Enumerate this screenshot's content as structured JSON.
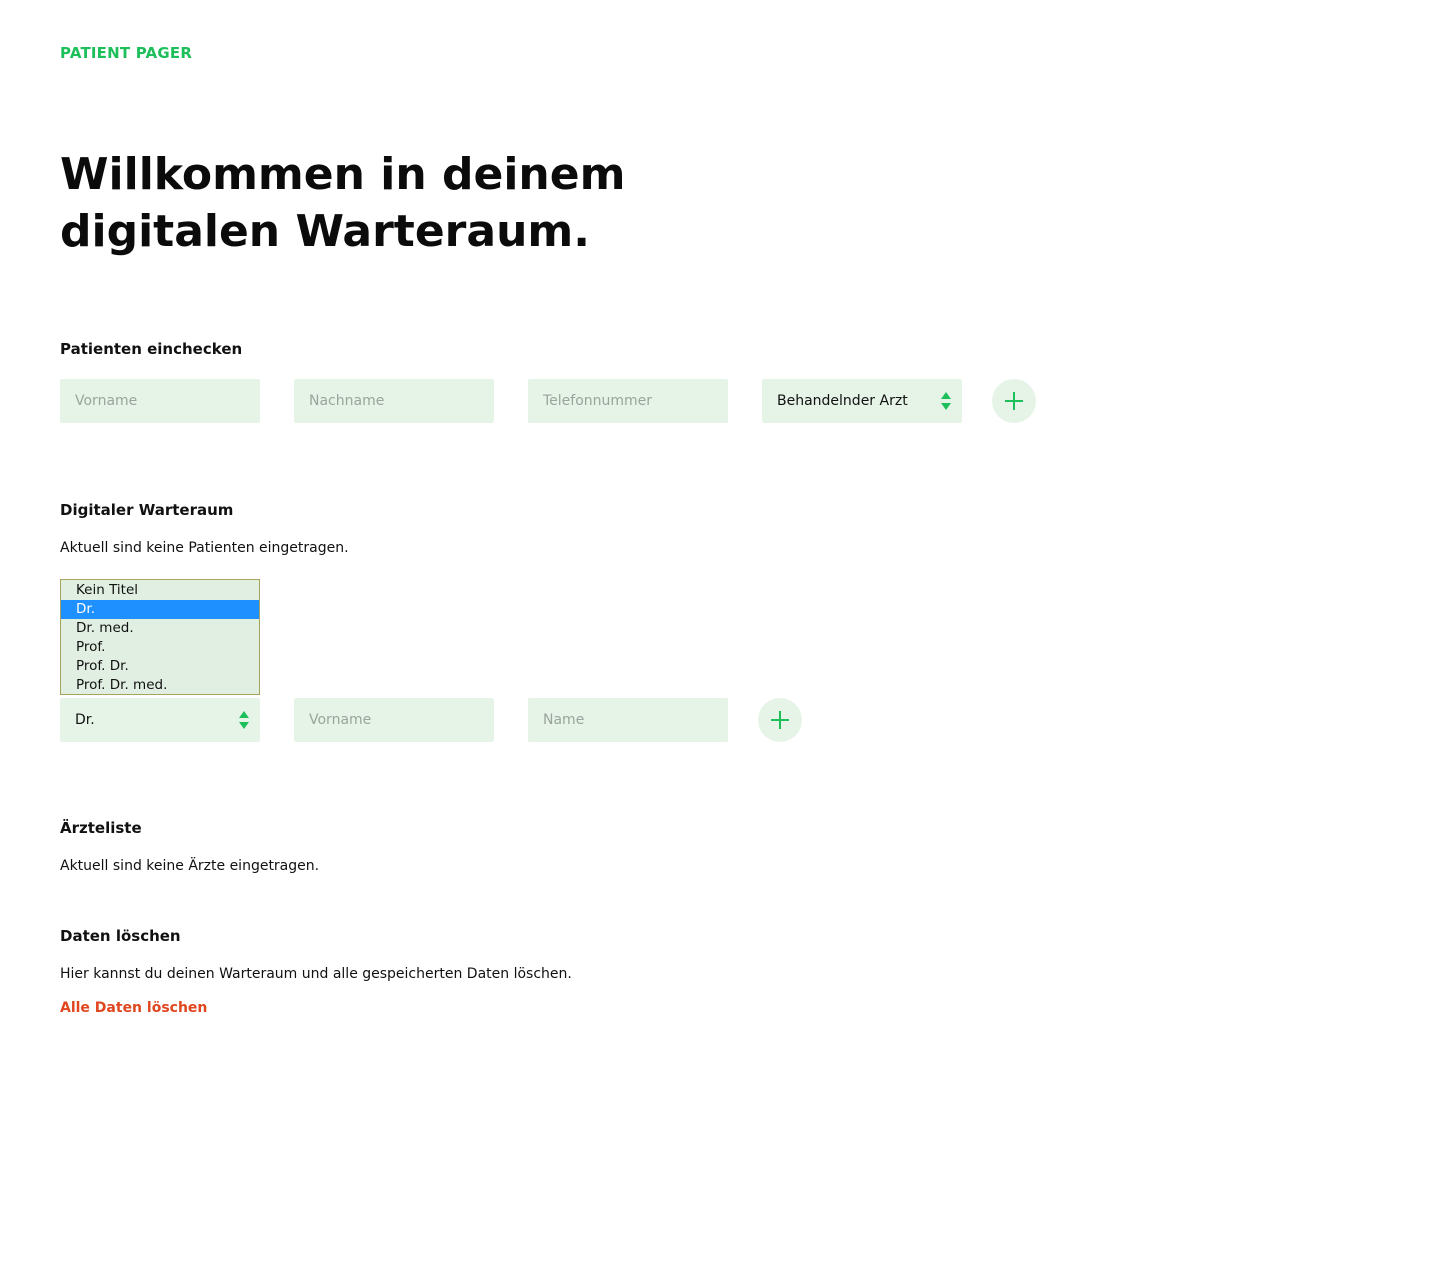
{
  "brand": "PATIENT PAGER",
  "hero": {
    "line1": "Willkommen in deinem",
    "line2": "digitalen Warteraum."
  },
  "checkin": {
    "title": "Patienten einchecken",
    "firstname_placeholder": "Vorname",
    "lastname_placeholder": "Nachname",
    "phone_placeholder": "Telefonnummer",
    "doctor_select_value": "Behandelnder Arzt",
    "add_icon": "plus-icon"
  },
  "waitingroom": {
    "title": "Digitaler Warteraum",
    "empty_text": "Aktuell sind keine Patienten eingetragen."
  },
  "doctor_form": {
    "title_options": [
      "Kein Titel",
      "Dr.",
      "Dr. med.",
      "Prof.",
      "Prof. Dr.",
      "Prof. Dr. med."
    ],
    "selected_option": "Dr.",
    "title_select_value": "Dr.",
    "firstname_placeholder": "Vorname",
    "name_placeholder": "Name",
    "add_icon": "plus-icon"
  },
  "doctorlist": {
    "title": "Ärzteliste",
    "empty_text": "Aktuell sind keine Ärzte eingetragen."
  },
  "delete": {
    "title": "Daten löschen",
    "description": "Hier kannst du deinen Warteraum und alle gespeicherten Daten löschen.",
    "link_label": "Alle Daten löschen"
  },
  "colors": {
    "accent": "#1cbf5a",
    "field_bg": "#e6f4e8",
    "danger": "#e0471f",
    "selection": "#1e90ff"
  }
}
